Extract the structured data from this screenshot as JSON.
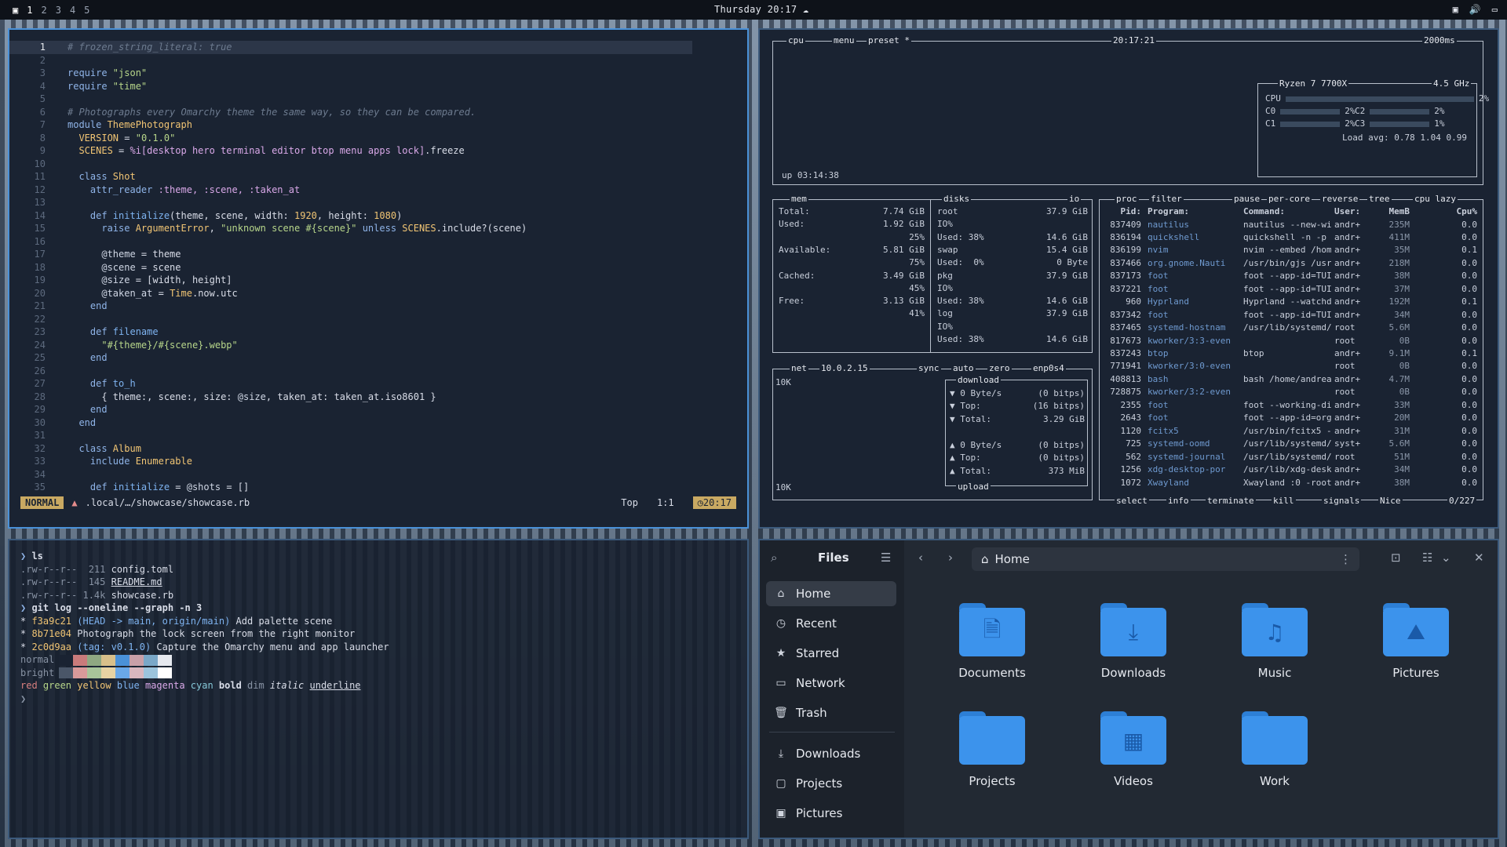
{
  "topbar": {
    "workspaces": [
      "1",
      "2",
      "3",
      "4",
      "5"
    ],
    "clock": "Thursday 20:17"
  },
  "editor": {
    "lines": [
      [
        {
          "t": "# frozen_string_literal: true",
          "c": "cm"
        }
      ],
      [],
      [
        {
          "t": "require ",
          "c": "kw"
        },
        {
          "t": "\"json\"",
          "c": "str"
        }
      ],
      [
        {
          "t": "require ",
          "c": "kw"
        },
        {
          "t": "\"time\"",
          "c": "str"
        }
      ],
      [],
      [
        {
          "t": "# Photographs every Omarchy theme the same way, so they can be compared.",
          "c": "cm"
        }
      ],
      [
        {
          "t": "module ",
          "c": "kw"
        },
        {
          "t": "ThemePhotograph",
          "c": "con"
        }
      ],
      [
        {
          "t": "  VERSION",
          "c": "con"
        },
        {
          "t": " = ",
          "c": ""
        },
        {
          "t": "\"0.1.0\"",
          "c": "str"
        }
      ],
      [
        {
          "t": "  SCENES",
          "c": "con"
        },
        {
          "t": " = ",
          "c": ""
        },
        {
          "t": "%i[desktop hero terminal editor btop menu apps lock]",
          "c": "sym"
        },
        {
          "t": ".freeze",
          "c": ""
        }
      ],
      [],
      [
        {
          "t": "  class ",
          "c": "kw"
        },
        {
          "t": "Shot",
          "c": "con"
        }
      ],
      [
        {
          "t": "    attr_reader ",
          "c": "kw"
        },
        {
          "t": ":theme, :scene, :taken_at",
          "c": "sym"
        }
      ],
      [],
      [
        {
          "t": "    def ",
          "c": "kw"
        },
        {
          "t": "initialize",
          "c": "fn"
        },
        {
          "t": "(theme, scene, width: ",
          "c": ""
        },
        {
          "t": "1920",
          "c": "con"
        },
        {
          "t": ", height: ",
          "c": ""
        },
        {
          "t": "1080",
          "c": "con"
        },
        {
          "t": ")",
          "c": ""
        }
      ],
      [
        {
          "t": "      raise ",
          "c": "kw"
        },
        {
          "t": "ArgumentError",
          "c": "con"
        },
        {
          "t": ", ",
          "c": ""
        },
        {
          "t": "\"unknown scene #{scene}\"",
          "c": "str"
        },
        {
          "t": " unless ",
          "c": "kw"
        },
        {
          "t": "SCENES",
          "c": "con"
        },
        {
          "t": ".include?(scene)",
          "c": ""
        }
      ],
      [],
      [
        {
          "t": "      @theme",
          "c": "iv"
        },
        {
          "t": " = theme",
          "c": ""
        }
      ],
      [
        {
          "t": "      @scene",
          "c": "iv"
        },
        {
          "t": " = scene",
          "c": ""
        }
      ],
      [
        {
          "t": "      @size",
          "c": "iv"
        },
        {
          "t": " = [width, height]",
          "c": ""
        }
      ],
      [
        {
          "t": "      @taken_at",
          "c": "iv"
        },
        {
          "t": " = ",
          "c": ""
        },
        {
          "t": "Time",
          "c": "con"
        },
        {
          "t": ".now.utc",
          "c": ""
        }
      ],
      [
        {
          "t": "    end",
          "c": "kw"
        }
      ],
      [],
      [
        {
          "t": "    def ",
          "c": "kw"
        },
        {
          "t": "filename",
          "c": "fn"
        }
      ],
      [
        {
          "t": "      \"#{theme}/#{scene}.webp\"",
          "c": "str"
        }
      ],
      [
        {
          "t": "    end",
          "c": "kw"
        }
      ],
      [],
      [
        {
          "t": "    def ",
          "c": "kw"
        },
        {
          "t": "to_h",
          "c": "fn"
        }
      ],
      [
        {
          "t": "      { theme:, scene:, size: ",
          "c": ""
        },
        {
          "t": "@size",
          "c": "iv"
        },
        {
          "t": ", taken_at: taken_at.iso8601 }",
          "c": ""
        }
      ],
      [
        {
          "t": "    end",
          "c": "kw"
        }
      ],
      [
        {
          "t": "  end",
          "c": "kw"
        }
      ],
      [],
      [
        {
          "t": "  class ",
          "c": "kw"
        },
        {
          "t": "Album",
          "c": "con"
        }
      ],
      [
        {
          "t": "    include ",
          "c": "kw"
        },
        {
          "t": "Enumerable",
          "c": "con"
        }
      ],
      [],
      [
        {
          "t": "    def ",
          "c": "kw"
        },
        {
          "t": "initialize",
          "c": "fn"
        },
        {
          "t": " = ",
          "c": ""
        },
        {
          "t": "@shots",
          "c": "iv"
        },
        {
          "t": " = []",
          "c": ""
        }
      ]
    ],
    "status": {
      "mode": "NORMAL",
      "path": ".local/…/showcase/showcase.rb",
      "pos": "Top",
      "cursor": "1:1",
      "clock": "20:17"
    }
  },
  "btop": {
    "cpu": {
      "tab": "cpu",
      "menu": "menu",
      "preset": "preset *",
      "time": "20:17:21",
      "interval": "2000ms",
      "model": "Ryzen 7 7700X",
      "freq": "4.5 GHz",
      "uptime": "up 03:14:38",
      "loadavg": "Load avg: 0.78 1.04 0.99",
      "cores": [
        {
          "name": "CPU",
          "pct": "2%",
          "v": 0.02
        },
        {
          "name": "C0",
          "pct": "2%",
          "v": 0.02
        },
        {
          "name": "C2",
          "pct": "2%",
          "v": 0.02
        },
        {
          "name": "C1",
          "pct": "2%",
          "v": 0.02
        },
        {
          "name": "C3",
          "pct": "1%",
          "v": 0.01
        }
      ]
    },
    "mem": {
      "title": "mem",
      "rows": [
        [
          "Total:",
          "7.74 GiB"
        ],
        [
          "Used:",
          "1.92 GiB"
        ],
        [
          "",
          "25%"
        ],
        [
          "Available:",
          "5.81 GiB"
        ],
        [
          "",
          "75%"
        ],
        [
          "Cached:",
          "3.49 GiB"
        ],
        [
          "",
          "45%"
        ],
        [
          "Free:",
          "3.13 GiB"
        ],
        [
          "",
          "41%"
        ]
      ]
    },
    "disks": {
      "title": "disks",
      "io": "io",
      "rows": [
        [
          "root",
          "37.9 GiB"
        ],
        [
          "IO%",
          ""
        ],
        [
          "Used: 38%",
          "14.6 GiB"
        ],
        [
          "swap",
          "15.4 GiB"
        ],
        [
          "Used:  0%",
          "0 Byte"
        ],
        [
          "pkg",
          "37.9 GiB"
        ],
        [
          "IO%",
          ""
        ],
        [
          "Used: 38%",
          "14.6 GiB"
        ],
        [
          "log",
          "37.9 GiB"
        ],
        [
          "IO%",
          ""
        ],
        [
          "Used: 38%",
          "14.6 GiB"
        ]
      ]
    },
    "net": {
      "title": "net",
      "ip": "10.0.2.15",
      "sync": "sync",
      "auto": "auto",
      "zero": "zero",
      "iface": "enp0s4",
      "scale": "10K",
      "download": "download",
      "upload": "upload",
      "down": [
        [
          "▼ 0 Byte/s",
          "(0 bitps)"
        ],
        [
          "▼ Top:",
          "(16 bitps)"
        ],
        [
          "▼ Total:",
          "3.29 GiB"
        ]
      ],
      "up": [
        [
          "▲ 0 Byte/s",
          "(0 bitps)"
        ],
        [
          "▲ Top:",
          "(0 bitps)"
        ],
        [
          "▲ Total:",
          "373 MiB"
        ]
      ]
    },
    "proc": {
      "title": "proc",
      "filter": "filter",
      "opts": [
        "pause",
        "per-core",
        "reverse",
        "tree",
        "cpu lazy"
      ],
      "cols": [
        "Pid:",
        "Program:",
        "Command:",
        "User:",
        "MemB",
        "Cpu%"
      ],
      "rows": [
        [
          "837409",
          "nautilus",
          "nautilus --new-win",
          "andr+",
          "235M",
          "0.0"
        ],
        [
          "836194",
          "quickshell",
          "quickshell -n -p /",
          "andr+",
          "411M",
          "0.0"
        ],
        [
          "836199",
          "nvim",
          "nvim --embed /home",
          "andr+",
          "35M",
          "0.1"
        ],
        [
          "837466",
          "org.gnome.Nauti",
          "/usr/bin/gjs /usr/",
          "andr+",
          "218M",
          "0.0"
        ],
        [
          "837173",
          "foot",
          "foot --app-id=TUI.",
          "andr+",
          "38M",
          "0.0"
        ],
        [
          "837221",
          "foot",
          "foot --app-id=TUI.",
          "andr+",
          "37M",
          "0.0"
        ],
        [
          "960",
          "Hyprland",
          "Hyprland --watchdo",
          "andr+",
          "192M",
          "0.1"
        ],
        [
          "837342",
          "foot",
          "foot --app-id=TUI.",
          "andr+",
          "34M",
          "0.0"
        ],
        [
          "837465",
          "systemd-hostnam",
          "/usr/lib/systemd/s",
          "root",
          "5.6M",
          "0.0"
        ],
        [
          "817673",
          "kworker/3:3-even",
          "",
          "root",
          "0B",
          "0.0"
        ],
        [
          "837243",
          "btop",
          "btop",
          "andr+",
          "9.1M",
          "0.1"
        ],
        [
          "771941",
          "kworker/3:0-even",
          "",
          "root",
          "0B",
          "0.0"
        ],
        [
          "408813",
          "bash",
          "bash /home/andreas",
          "andr+",
          "4.7M",
          "0.0"
        ],
        [
          "728875",
          "kworker/3:2-even",
          "",
          "root",
          "0B",
          "0.0"
        ],
        [
          "2355",
          "foot",
          "foot --working-dir",
          "andr+",
          "33M",
          "0.0"
        ],
        [
          "2643",
          "foot",
          "foot --app-id=org.",
          "andr+",
          "20M",
          "0.0"
        ],
        [
          "1120",
          "fcitx5",
          "/usr/bin/fcitx5 --",
          "andr+",
          "31M",
          "0.0"
        ],
        [
          "725",
          "systemd-oomd",
          "/usr/lib/systemd/s",
          "syst+",
          "5.6M",
          "0.0"
        ],
        [
          "562",
          "systemd-journal",
          "/usr/lib/systemd/s",
          "root",
          "51M",
          "0.0"
        ],
        [
          "1256",
          "xdg-desktop-por",
          "/usr/lib/xdg-deskt",
          "andr+",
          "34M",
          "0.0"
        ],
        [
          "1072",
          "Xwayland",
          "Xwayland :0 -rootl",
          "andr+",
          "38M",
          "0.0"
        ]
      ],
      "footer": [
        "select",
        "info",
        "terminate",
        "kill",
        "signals",
        "Nice"
      ],
      "count": "0/227"
    }
  },
  "terminal": {
    "lines": [
      [
        {
          "t": "❯ ",
          "c": "kw"
        },
        {
          "t": "ls",
          "c": "b"
        }
      ],
      [
        {
          "t": ".rw-r--r--  211 ",
          "c": "dim"
        },
        {
          "t": "config.toml",
          "c": ""
        }
      ],
      [
        {
          "t": ".rw-r--r--  145 ",
          "c": "dim"
        },
        {
          "t": "README.md",
          "c": "u"
        }
      ],
      [
        {
          "t": ".rw-r--r-- 1.4k ",
          "c": "dim"
        },
        {
          "t": "showcase.rb",
          "c": ""
        }
      ],
      [
        {
          "t": "❯ ",
          "c": "kw"
        },
        {
          "t": "git log --oneline --graph -n 3",
          "c": "b"
        }
      ],
      [
        {
          "t": "* ",
          "c": ""
        },
        {
          "t": "f3a9c21 ",
          "c": "con"
        },
        {
          "t": "(HEAD -> main, origin/main)",
          "c": "fn"
        },
        {
          "t": " Add palette scene",
          "c": ""
        }
      ],
      [
        {
          "t": "* ",
          "c": ""
        },
        {
          "t": "8b71e04 ",
          "c": "con"
        },
        {
          "t": "Photograph the lock screen from the right monitor",
          "c": ""
        }
      ],
      [
        {
          "t": "* ",
          "c": ""
        },
        {
          "t": "2c0d9aa ",
          "c": "con"
        },
        {
          "t": "(tag: v0.1.0)",
          "c": "fn"
        },
        {
          "t": " Capture the Omarchy menu and app launcher",
          "c": ""
        }
      ],
      [
        {
          "t": "normal",
          "c": "dim"
        }
      ],
      [
        {
          "t": "bright",
          "c": "dim"
        }
      ],
      [
        {
          "t": "red ",
          "c": "red"
        },
        {
          "t": "green ",
          "c": "str"
        },
        {
          "t": "yellow ",
          "c": "con"
        },
        {
          "t": "blue ",
          "c": "fn"
        },
        {
          "t": "magenta ",
          "c": "sym"
        },
        {
          "t": "cyan ",
          "c": "cy"
        },
        {
          "t": "bold ",
          "c": "b"
        },
        {
          "t": "dim ",
          "c": "dim"
        },
        {
          "t": "italic ",
          "c": "it"
        },
        {
          "t": "underline",
          "c": "u"
        }
      ],
      [
        {
          "t": "❯",
          "c": "dim"
        }
      ]
    ],
    "palette_normal": [
      "#1a2332",
      "#c97b7b",
      "#8fa882",
      "#d9c08a",
      "#4a91d8",
      "#c9a0a8",
      "#7aa8c8",
      "#e6e9ef"
    ],
    "palette_bright": [
      "#4a5668",
      "#d99a9a",
      "#a8c49a",
      "#e8d3a3",
      "#6aa8e8",
      "#d9b7be",
      "#9cc4dc",
      "#ffffff"
    ]
  },
  "files": {
    "title": "Files",
    "path": "Home",
    "sidebar": [
      {
        "label": "Home",
        "icon": "⌂"
      },
      {
        "label": "Recent",
        "icon": "◷"
      },
      {
        "label": "Starred",
        "icon": "★"
      },
      {
        "label": "Network",
        "icon": "▭"
      },
      {
        "label": "Trash",
        "icon": "🗑"
      },
      {
        "label": "Downloads",
        "icon": "⤓"
      },
      {
        "label": "Projects",
        "icon": "▢"
      },
      {
        "label": "Pictures",
        "icon": "▣"
      }
    ],
    "items": [
      {
        "label": "Documents",
        "icon": "🗎"
      },
      {
        "label": "Downloads",
        "icon": "⤓"
      },
      {
        "label": "Music",
        "icon": "♫"
      },
      {
        "label": "Pictures",
        "icon": "⛰"
      },
      {
        "label": "Projects",
        "icon": ""
      },
      {
        "label": "Videos",
        "icon": "▦"
      },
      {
        "label": "Work",
        "icon": ""
      }
    ]
  }
}
